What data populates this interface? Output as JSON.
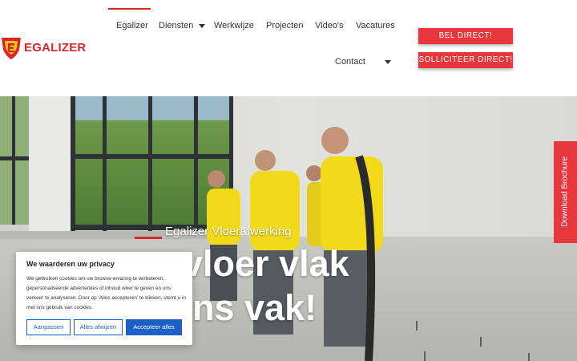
{
  "header": {
    "logo_text": "EGALIZER",
    "nav": [
      {
        "label": "Egalizer",
        "active": true
      },
      {
        "label": "Diensten",
        "dropdown": true
      },
      {
        "label": "Werkwijze"
      },
      {
        "label": "Projecten"
      },
      {
        "label": "Video's"
      },
      {
        "label": "Vacatures"
      }
    ],
    "contact_label": "Contact",
    "cta_call": "BEL DIRECT!",
    "cta_apply": "SOLLICITEER DIRECT!"
  },
  "hero": {
    "subtitle": "Egalizer Vloerafwerking",
    "title_line1": "vloer vlak",
    "title_line2": "ns vak!"
  },
  "side_tab": {
    "label": "Download Brochure"
  },
  "cookie": {
    "title": "We waarderen uw privacy",
    "body": "We gebruiken cookies om uw browse-ervaring te verbeteren, gepersonaliseerde advertenties of inhoud weer te geven en ons verkeer te analyseren. Door op 'Alles accepteren' te klikken, stemt u in met ons gebruik van cookies.",
    "btn_customize": "Aanpassen",
    "btn_reject": "Alles afwijzen",
    "btn_accept": "Accepteer alles"
  },
  "colors": {
    "brand_red": "#d7252b",
    "button_red": "#e8363d",
    "cookie_blue": "#1d5fc9"
  }
}
